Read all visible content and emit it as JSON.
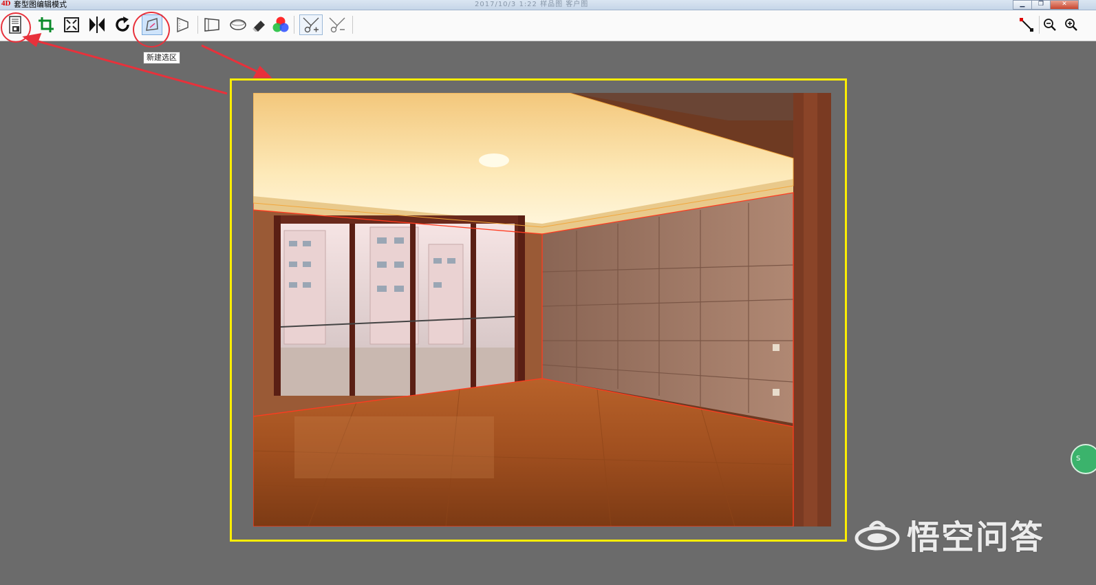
{
  "window": {
    "title": "套型图编辑模式",
    "logo_text": "4D",
    "ghost_title": "2017/10/3  1:22  样品图  客户图",
    "controls": [
      "minimize",
      "maximize",
      "close"
    ]
  },
  "toolbar": {
    "left_tools": [
      {
        "name": "save-tool",
        "icon": "save-icon",
        "highlighted_circle": true
      },
      {
        "name": "crop-tool",
        "icon": "crop-icon"
      },
      {
        "name": "fit-tool",
        "icon": "fit-to-window-icon"
      },
      {
        "name": "mirror-tool",
        "icon": "flip-horizontal-icon"
      },
      {
        "name": "rotate-tool",
        "icon": "rotate-icon"
      },
      {
        "name": "new-selection-tool",
        "icon": "new-selection-icon",
        "active": true,
        "highlighted_circle": true
      },
      {
        "name": "triangle-selection-tool",
        "icon": "triangle-selection-icon"
      },
      {
        "name": "wall-tool",
        "icon": "perspective-wall-icon"
      },
      {
        "name": "ellipse-tool",
        "icon": "ellipse-icon"
      },
      {
        "name": "eraser-tool",
        "icon": "eraser-icon"
      },
      {
        "name": "color-tool",
        "icon": "rgb-color-icon"
      },
      {
        "name": "add-selection-tool",
        "icon": "scissor-plus-icon"
      },
      {
        "name": "subtract-selection-tool",
        "icon": "scissor-minus-icon"
      }
    ],
    "right_tools": [
      {
        "name": "measure-tool",
        "icon": "node-line-icon"
      },
      {
        "name": "zoom-out-tool",
        "icon": "zoom-out-icon"
      },
      {
        "name": "zoom-in-tool",
        "icon": "zoom-in-icon"
      }
    ]
  },
  "tooltip": {
    "text": "新建选区"
  },
  "watermark": {
    "text": "悟空问答"
  },
  "colors": {
    "canvas_bg": "#6b6b6b",
    "frame": "#ffee00",
    "annotation": "#e8313b",
    "selection_outline": "#ff3b1f"
  }
}
